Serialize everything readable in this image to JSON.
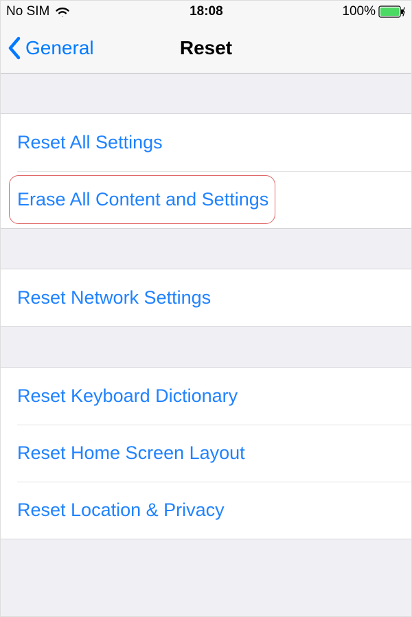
{
  "status": {
    "carrier": "No SIM",
    "time": "18:08",
    "battery_pct": "100%"
  },
  "nav": {
    "back_label": "General",
    "title": "Reset"
  },
  "groups": [
    {
      "items": [
        {
          "label": "Reset All Settings",
          "highlighted": false
        },
        {
          "label": "Erase All Content and Settings",
          "highlighted": true
        }
      ]
    },
    {
      "items": [
        {
          "label": "Reset Network Settings",
          "highlighted": false
        }
      ]
    },
    {
      "items": [
        {
          "label": "Reset Keyboard Dictionary",
          "highlighted": false
        },
        {
          "label": "Reset Home Screen Layout",
          "highlighted": false
        },
        {
          "label": "Reset Location & Privacy",
          "highlighted": false
        }
      ]
    }
  ]
}
